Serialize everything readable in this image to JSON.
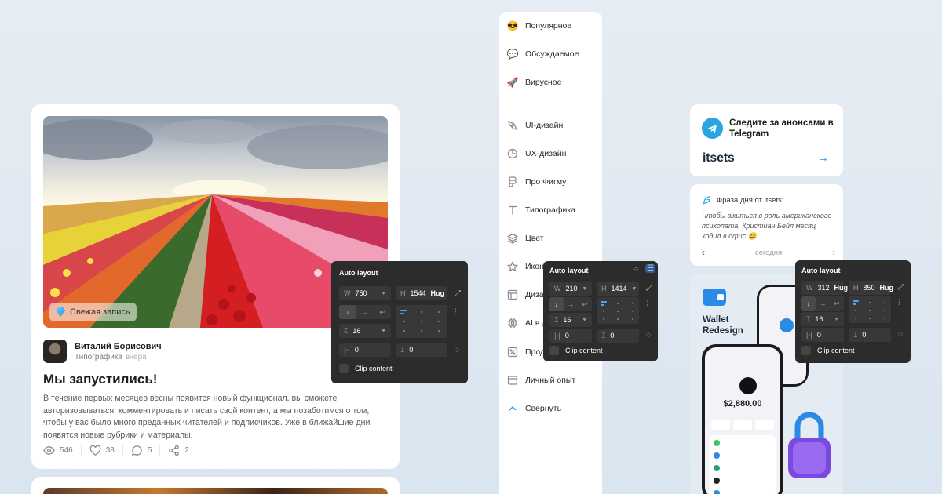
{
  "post": {
    "badge": "Свежая запись",
    "author_name": "Виталий Борисович",
    "author_category": "Типографика",
    "author_time": "вчера",
    "title": "Мы запустились!",
    "text": "В течение первых месяцев весны появится новый функционал, вы сможете авторизовываться, комментировать и писать свой контент, а мы позаботимся о том, чтобы у вас было много преданных читателей и подписчиков. Уже в ближайшие дни появятся новые рубрики и материалы.",
    "stats": {
      "views": "546",
      "likes": "38",
      "comments": "5",
      "shares": "2"
    }
  },
  "sidebar": {
    "items": [
      {
        "label": "Популярное",
        "icon": "sunglasses-emoji-icon"
      },
      {
        "label": "Обсуждаемое",
        "icon": "speech-bubble-icon"
      },
      {
        "label": "Вирусное",
        "icon": "rocket-icon"
      },
      {
        "label": "UI-дизайн",
        "icon": "pen-tool-icon"
      },
      {
        "label": "UX-дизайн",
        "icon": "pie-chart-icon"
      },
      {
        "label": "Про Фигму",
        "icon": "figma-icon"
      },
      {
        "label": "Типографика",
        "icon": "type-icon"
      },
      {
        "label": "Цвет",
        "icon": "layers-icon"
      },
      {
        "label": "Иконки",
        "icon": "star-icon"
      },
      {
        "label": "Дизайн-системы",
        "icon": "layout-icon"
      },
      {
        "label": "AI в дизайне",
        "icon": "chip-icon"
      },
      {
        "label": "Продуктовый дизайн",
        "icon": "percent-icon"
      },
      {
        "label": "Личный опыт",
        "icon": "folder-icon"
      },
      {
        "label": "Свернуть",
        "icon": "chevron-up-icon"
      }
    ]
  },
  "telegram": {
    "text": "Следите за анонсами в Telegram",
    "logo": "itsets",
    "arrow": "→"
  },
  "phrase": {
    "title": "Фраза дня от itsets:",
    "text": "Чтобы вжиться в роль американского психопата, Кристиан Бейл месяц ходил в офис 😄",
    "nav_label": "сегодня",
    "prev": "‹",
    "next": "›"
  },
  "wallet": {
    "title": "Wallet Redesign",
    "balance": "$2,880.00"
  },
  "auto_layout": {
    "title": "Auto layout",
    "clip": "Clip content",
    "hug": "Hug",
    "panels": [
      {
        "w": "750",
        "h": "1544",
        "gap": "16",
        "pad_h": "0",
        "pad_v": "0"
      },
      {
        "w": "210",
        "h": "1414",
        "gap": "16",
        "pad_h": "0",
        "pad_v": "0"
      },
      {
        "w": "312",
        "h": "850",
        "gap": "16",
        "pad_h": "0",
        "pad_v": "0"
      }
    ]
  },
  "colors": {
    "accent": "#2a8ae6",
    "telegram": "#2aa5e0",
    "panel": "#2c2c2c"
  }
}
